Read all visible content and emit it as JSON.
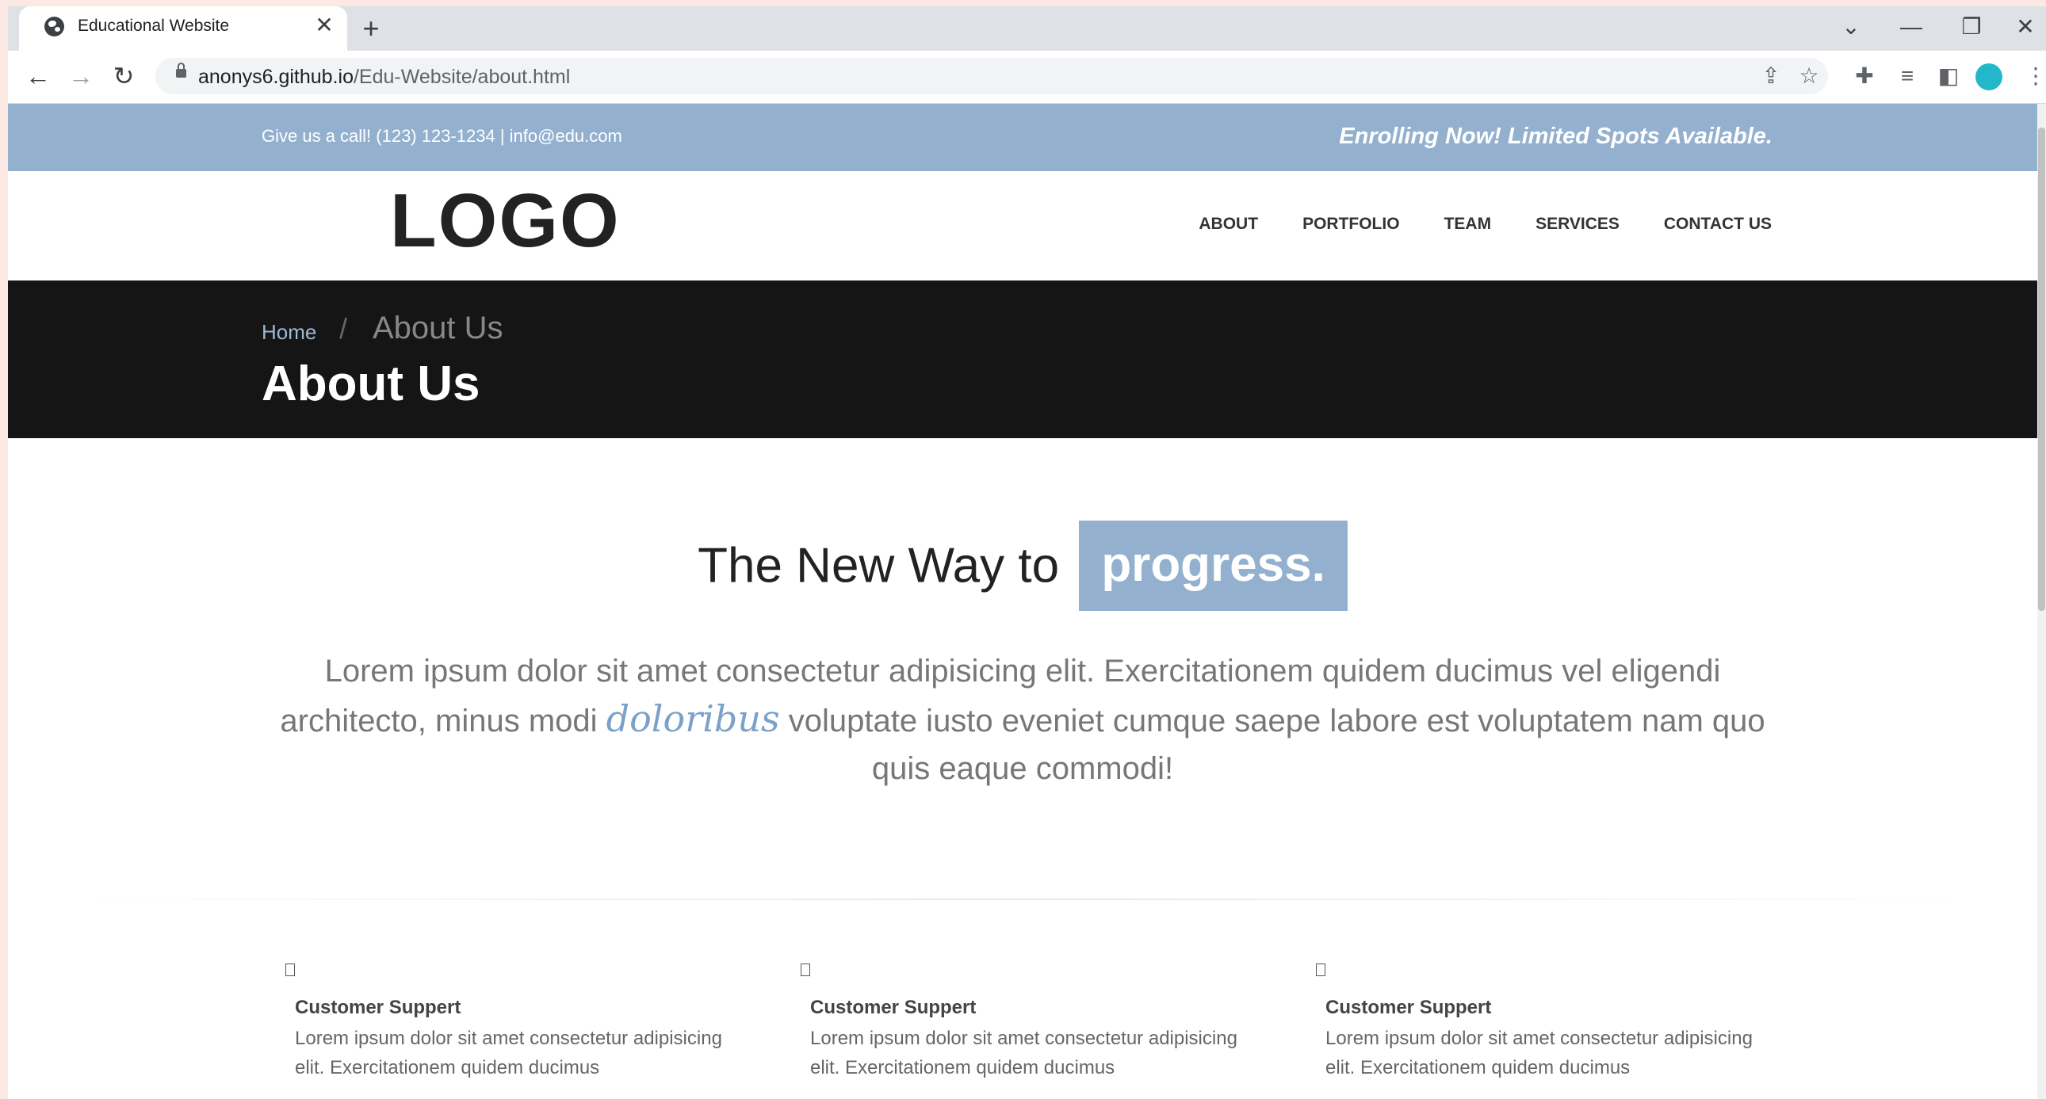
{
  "browser": {
    "tab_title": "Educational Website",
    "tab_close": "✕",
    "new_tab": "+",
    "window_controls": {
      "tab_search": "⌄",
      "minimize": "—",
      "restore": "❐",
      "close": "✕"
    },
    "nav": {
      "back": "←",
      "forward": "→",
      "reload": "↻"
    },
    "url_host": "anonys6.github.io",
    "url_path": "/Edu-Website/about.html",
    "toolbar_icons": {
      "share": "⇪",
      "bookmark": "☆",
      "extensions": "✚",
      "reading_list": "≡",
      "side_panel": "◧",
      "menu": "⋮"
    }
  },
  "site": {
    "topbar": {
      "contact_text": "Give us a call! (123) 123-1234 | info@edu.com",
      "enroll_text": "Enrolling Now! Limited Spots Available."
    },
    "logo": "LOGO",
    "nav": [
      "ABOUT",
      "PORTFOLIO",
      "TEAM",
      "SERVICES",
      "CONTACT US"
    ],
    "breadcrumb": {
      "home": "Home",
      "separator": "/",
      "current": "About Us"
    },
    "hero_title": "About Us",
    "intro": {
      "heading_prefix": "The New Way to",
      "heading_highlight": "progress.",
      "lead_before": "Lorem ipsum dolor sit amet consectetur adipisicing elit. Exercitationem quidem ducimus vel eligendi architecto, minus modi",
      "lead_cursive": "doloribus",
      "lead_after": "voluptate iusto eveniet cumque saepe labore est voluptatem nam quo quis eaque commodi!"
    },
    "features": [
      {
        "title": "Customer Suppert",
        "text": "Lorem ipsum dolor sit amet consectetur adipisicing elit. Exercitationem quidem ducimus"
      },
      {
        "title": "Customer Suppert",
        "text": "Lorem ipsum dolor sit amet consectetur adipisicing elit. Exercitationem quidem ducimus"
      },
      {
        "title": "Customer Suppert",
        "text": "Lorem ipsum dolor sit amet consectetur adipisicing elit. Exercitationem quidem ducimus"
      }
    ]
  },
  "colors": {
    "accent": "#93b1cf",
    "hero_bg": "#151515",
    "profile": "#22b8c9"
  }
}
